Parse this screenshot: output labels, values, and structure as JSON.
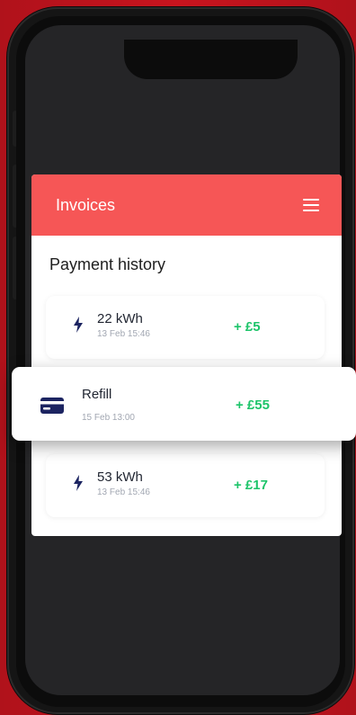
{
  "app": {
    "title": "Invoices"
  },
  "section": {
    "title": "Payment history"
  },
  "transactions": [
    {
      "title": "22 kWh",
      "date": "13 Feb 15:46",
      "amount": "+ £5",
      "icon": "lightning-icon"
    },
    {
      "title": "Refill",
      "date": "15 Feb 13:00",
      "amount": "+ £55",
      "icon": "card-icon"
    },
    {
      "title": "53 kWh",
      "date": "13 Feb 15:46",
      "amount": "+ £17",
      "icon": "lightning-icon"
    }
  ],
  "colors": {
    "header": "#f65656",
    "amount": "#1dc46a",
    "icon": "#1c2461",
    "background": "#c8141e"
  }
}
